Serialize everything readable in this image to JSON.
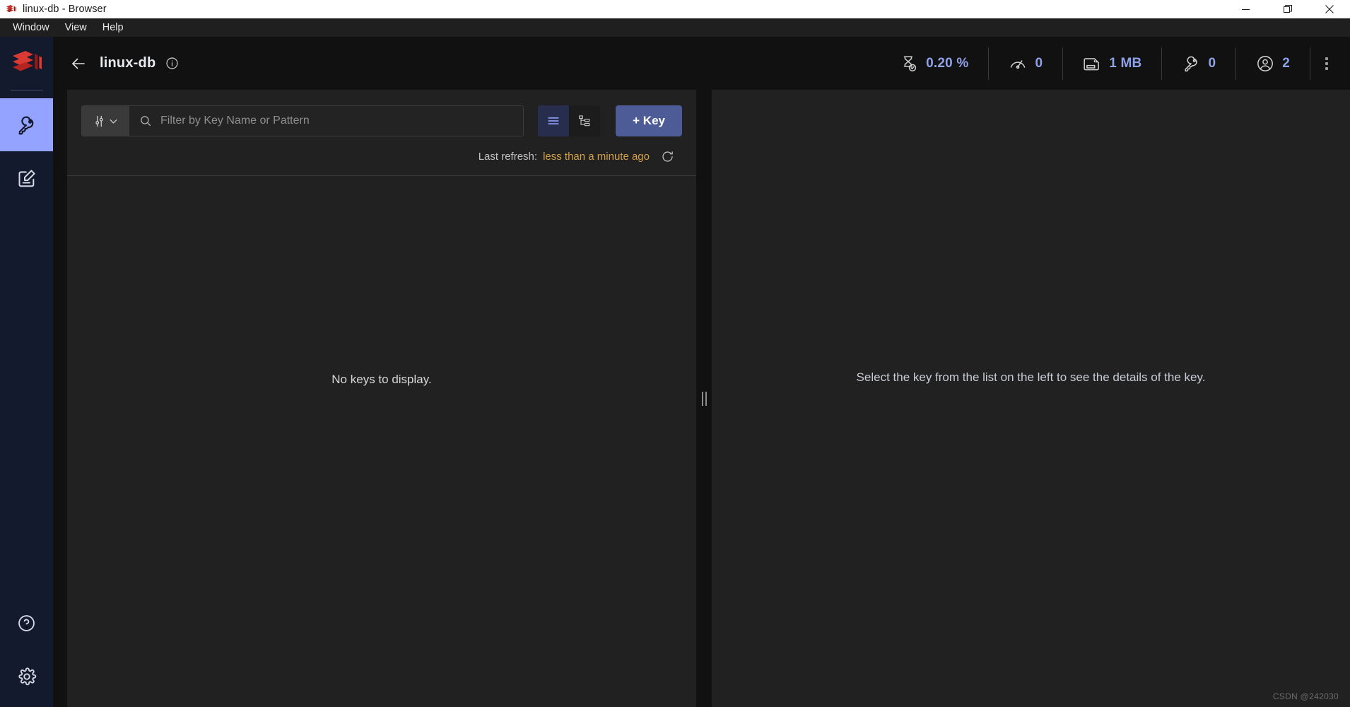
{
  "window": {
    "title": "linux-db - Browser",
    "controls": {
      "minimize": "minimize",
      "restore": "restore",
      "close": "close"
    }
  },
  "menubar": {
    "items": [
      {
        "label": "Window"
      },
      {
        "label": "View"
      },
      {
        "label": "Help"
      }
    ]
  },
  "sidebar": {
    "logo": "redis-logo",
    "items": [
      {
        "name": "browser",
        "icon": "key-icon",
        "active": true
      },
      {
        "name": "workbench",
        "icon": "edit-square-icon",
        "active": false
      }
    ],
    "bottom_items": [
      {
        "name": "help",
        "icon": "question-circle-icon"
      },
      {
        "name": "settings",
        "icon": "gear-icon"
      }
    ]
  },
  "header": {
    "back_icon": "arrow-left-icon",
    "db_name": "linux-db",
    "info_icon": "info-circle-icon",
    "overflow_icon": "more-vertical-icon",
    "stats": [
      {
        "icon": "hourglass-check-icon",
        "value": "0.20 %",
        "name": "cpu-stat"
      },
      {
        "icon": "speedometer-icon",
        "value": "0",
        "name": "commands-stat"
      },
      {
        "icon": "memory-card-icon",
        "value": "1 MB",
        "name": "memory-stat"
      },
      {
        "icon": "key-icon",
        "value": "0",
        "name": "keys-stat"
      },
      {
        "icon": "user-circle-icon",
        "value": "2",
        "name": "connections-stat"
      }
    ]
  },
  "keys_panel": {
    "filter": {
      "icon": "sliders-icon",
      "chevron": "chevron-down-icon",
      "search_icon": "search-icon",
      "placeholder": "Filter by Key Name or Pattern",
      "value": ""
    },
    "view_buttons": [
      {
        "name": "list-view",
        "icon": "list-icon",
        "active": true
      },
      {
        "name": "tree-view",
        "icon": "tree-icon",
        "active": false
      }
    ],
    "add_key_label": "+ Key",
    "refresh": {
      "label": "Last refresh:",
      "value": "less than a minute ago",
      "icon": "refresh-icon"
    },
    "empty_message": "No keys to display."
  },
  "details_panel": {
    "empty_message": "Select the key from the list on the left to see the details of the key."
  },
  "watermark": "CSDN @242030",
  "colors": {
    "accent_blue": "#8fa2e8",
    "button_blue": "#4d5b96",
    "sidebar_bg": "#131a2e",
    "sidebar_active": "#93a3ff",
    "panel_bg": "#212121",
    "page_bg": "#111111",
    "refresh_amber": "#d4a04a",
    "redis_red": "#c9302c"
  }
}
